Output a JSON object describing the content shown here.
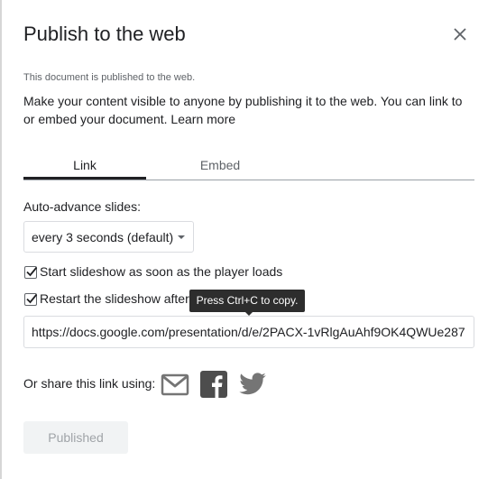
{
  "dialog": {
    "title": "Publish to the web",
    "status_text": "This document is published to the web.",
    "description": "Make your content visible to anyone by publishing it to the web. You can link to or embed your document.",
    "learn_more_label": "Learn more"
  },
  "tabs": [
    {
      "label": "Link",
      "active": true
    },
    {
      "label": "Embed",
      "active": false
    }
  ],
  "link_settings": {
    "auto_advance_label": "Auto-advance slides:",
    "auto_advance_value": "every 3 seconds (default)",
    "start_slideshow": {
      "label": "Start slideshow as soon as the player loads",
      "checked": true
    },
    "restart_slideshow": {
      "label": "Restart the slideshow after",
      "checked": true
    },
    "tooltip": "Press Ctrl+C to copy.",
    "url": "https://docs.google.com/presentation/d/e/2PACX-1vRlgAuAhf9OK4QWUe287"
  },
  "share": {
    "label": "Or share this link using:",
    "icons": [
      "gmail-icon",
      "facebook-icon",
      "twitter-icon"
    ]
  },
  "publish_button": {
    "label": "Published",
    "enabled": false
  },
  "colors": {
    "text": "#202124",
    "muted": "#5f6368",
    "border": "#dadce0",
    "tooltip_bg": "#2d2d2d",
    "disabled_button_bg": "#f1f3f4",
    "disabled_button_text": "#a0a4a8"
  }
}
